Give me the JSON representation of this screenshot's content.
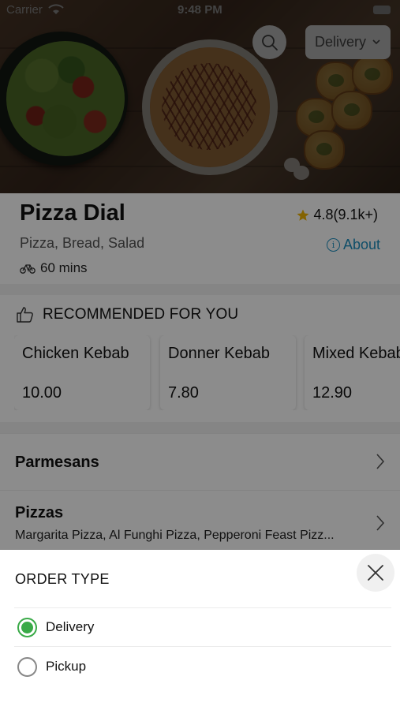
{
  "status_bar": {
    "carrier": "Carrier",
    "time": "9:48 PM"
  },
  "header": {
    "order_type_button": "Delivery"
  },
  "restaurant": {
    "name": "Pizza Dial",
    "rating": "4.8(9.1k+)",
    "cuisines": "Pizza, Bread, Salad",
    "about_label": "About",
    "delivery_time": "60 mins"
  },
  "recommended": {
    "heading": "RECOMMENDED FOR YOU",
    "items": [
      {
        "name": "Chicken Kebab",
        "price": "10.00"
      },
      {
        "name": "Donner Kebab",
        "price": "7.80"
      },
      {
        "name": "Mixed Kebab",
        "price": "12.90"
      }
    ]
  },
  "categories": [
    {
      "name": "Parmesans",
      "items": ""
    },
    {
      "name": "Pizzas",
      "items": "Margarita Pizza, Al Funghi Pizza, Pepperoni Feast Pizz..."
    }
  ],
  "order_sheet": {
    "title": "ORDER TYPE",
    "options": [
      {
        "label": "Delivery",
        "selected": true
      },
      {
        "label": "Pickup",
        "selected": false
      }
    ]
  },
  "colors": {
    "accent_green": "#3aaa48",
    "link_blue": "#1c8fbf",
    "star": "#f0b400"
  }
}
